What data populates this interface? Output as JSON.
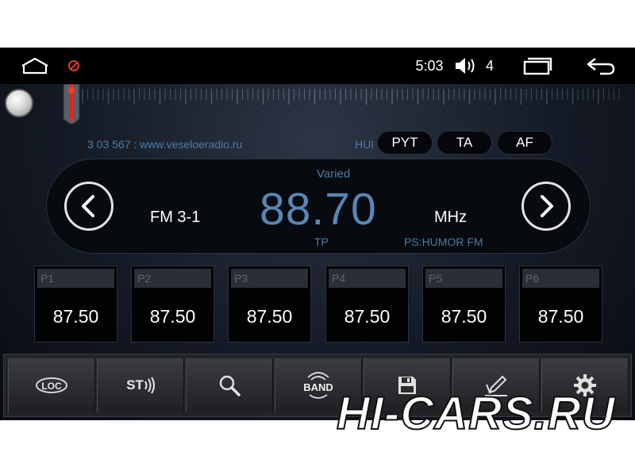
{
  "status_bar": {
    "home_icon": "home-icon",
    "blocked_icon": "no-entry-icon",
    "time": "5:03",
    "volume_icon": "speaker-icon",
    "volume_level": "4",
    "recent_icon": "recent-apps-icon",
    "back_icon": "back-arrow-icon"
  },
  "tuner": {
    "rds_text": "3 03 567 : www.veseloeradio.ru",
    "hu_text": "HUI",
    "buttons": {
      "pyt": "PYT",
      "ta": "TA",
      "af": "AF"
    }
  },
  "display": {
    "genre": "Varied",
    "band": "FM 3-1",
    "frequency": "88.70",
    "unit": "MHz",
    "tp": "TP",
    "ps": "PS:HUMOR FM"
  },
  "presets": [
    {
      "label": "P1",
      "freq": "87.50"
    },
    {
      "label": "P2",
      "freq": "87.50"
    },
    {
      "label": "P3",
      "freq": "87.50"
    },
    {
      "label": "P4",
      "freq": "87.50"
    },
    {
      "label": "P5",
      "freq": "87.50"
    },
    {
      "label": "P6",
      "freq": "87.50"
    }
  ],
  "toolbar": {
    "loc": "LOC",
    "st": "ST",
    "band": "BAND",
    "icons": [
      "loc-icon",
      "stereo-icon",
      "search-icon",
      "band-icon",
      "save-icon",
      "edit-icon",
      "settings-icon"
    ]
  },
  "watermark": "HI-CARS.RU",
  "colors": {
    "accent": "#5887b6",
    "secondary_text": "#4f7ba3",
    "alert": "#e03a2c"
  }
}
